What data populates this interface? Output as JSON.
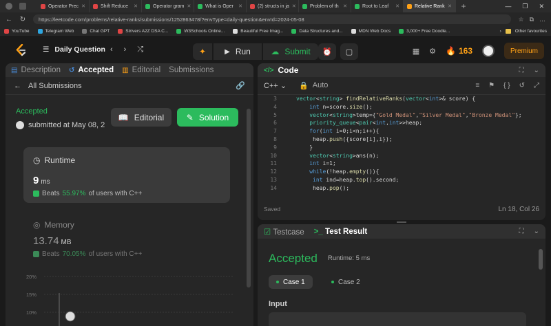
{
  "browser": {
    "tabs": [
      {
        "label": "Operator Prec",
        "color": "#e04545",
        "active": false
      },
      {
        "label": "Shift Reduce",
        "color": "#e04545",
        "active": false
      },
      {
        "label": "Operator gram",
        "color": "#2cbb5d",
        "active": false
      },
      {
        "label": "What is Oper",
        "color": "#2cbb5d",
        "active": false
      },
      {
        "label": "(2) structs in ja",
        "color": "#e04545",
        "active": false
      },
      {
        "label": "Problem of th",
        "color": "#2cbb5d",
        "active": false
      },
      {
        "label": "Root to Leaf",
        "color": "#2cbb5d",
        "active": false
      },
      {
        "label": "Relative Rank",
        "color": "#ffa116",
        "active": true
      }
    ],
    "url": "https://leetcode.com/problems/relative-ranks/submissions/1252863478/?envType=daily-question&envId=2024-05-08",
    "bookmarks": [
      {
        "label": "YouTube",
        "color": "#e04545"
      },
      {
        "label": "Telegram Web",
        "color": "#2ea6e0"
      },
      {
        "label": "Chat GPT",
        "color": "#777777"
      },
      {
        "label": "Strivers A2Z DSA C...",
        "color": "#e04545"
      },
      {
        "label": "W3Schools Online...",
        "color": "#2cbb5d"
      },
      {
        "label": "Beautiful Free Imag...",
        "color": "#dddddd"
      },
      {
        "label": "Data Structures and...",
        "color": "#2cbb5d"
      },
      {
        "label": "MDN Web Docs",
        "color": "#dddddd"
      },
      {
        "label": "3,000+ Free Doodle...",
        "color": "#2cbb5d"
      }
    ],
    "other_favourites": "Other favourites"
  },
  "nav": {
    "daily_question": "Daily Question",
    "run_label": "Run",
    "submit_label": "Submit",
    "streak": "163",
    "premium": "Premium"
  },
  "left": {
    "tabs": [
      "Description",
      "Accepted",
      "Editorial",
      "Submissions"
    ],
    "all_submissions": "All Submissions",
    "status": "Accepted",
    "submitted_at": "submitted at May 08, 2",
    "editorial_btn": "Editorial",
    "solution_btn": "Solution",
    "runtime": {
      "title": "Runtime",
      "value": "9",
      "unit": "ms",
      "beats_prefix": "Beats",
      "beats_pct": "55.97%",
      "beats_suffix": "of users with C++"
    },
    "memory": {
      "title": "Memory",
      "value": "13.74",
      "unit": "MB",
      "beats_prefix": "Beats",
      "beats_pct": "70.05%",
      "beats_suffix": "of users with C++"
    },
    "chart_ticks": [
      "20%",
      "15%",
      "10%"
    ]
  },
  "code": {
    "title": "Code",
    "language": "C++",
    "mode": "Auto",
    "saved": "Saved",
    "cursor": "Ln 18, Col 26",
    "lines": [
      {
        "n": "3",
        "t": "vector<string> findRelativeRanks(vector<int>& score) {"
      },
      {
        "n": "4",
        "t": "    int n=score.size();"
      },
      {
        "n": "5",
        "t": "    vector<string>temp={\"Gold Medal\",\"Silver Medal\",\"Bronze Medal\"};"
      },
      {
        "n": "6",
        "t": "    priority_queue<pair<int,int>>heap;"
      },
      {
        "n": "7",
        "t": "    for(int i=0;i<n;i++){"
      },
      {
        "n": "8",
        "t": "     heap.push({score[i],i});"
      },
      {
        "n": "9",
        "t": "    }"
      },
      {
        "n": "10",
        "t": "    vector<string>ans(n);"
      },
      {
        "n": "11",
        "t": "    int i=1;"
      },
      {
        "n": "12",
        "t": "    while(!heap.empty()){"
      },
      {
        "n": "13",
        "t": "     int ind=heap.top().second;"
      },
      {
        "n": "14",
        "t": "     heap.pop();"
      }
    ]
  },
  "test": {
    "tabs": [
      "Testcase",
      "Test Result"
    ],
    "status": "Accepted",
    "runtime": "Runtime: 5 ms",
    "cases": [
      "Case 1",
      "Case 2"
    ],
    "input_label": "Input"
  },
  "colors": {
    "accent": "#ffa116",
    "success": "#2cbb5d"
  }
}
